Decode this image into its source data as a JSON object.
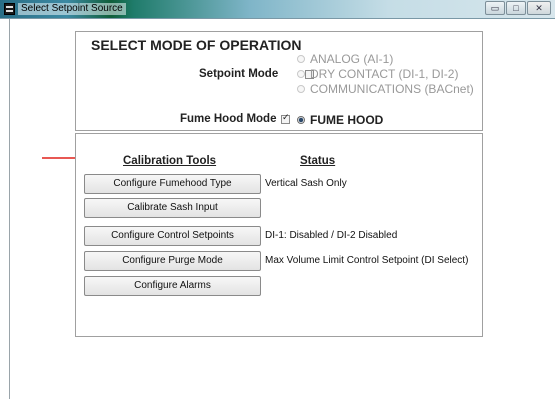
{
  "window": {
    "title": "Select Setpoint Source",
    "buttons": {
      "minimize": "▭",
      "maximize": "□",
      "close": "✕"
    }
  },
  "mode": {
    "heading": "SELECT MODE OF OPERATION",
    "setpoint_label": "Setpoint Mode",
    "setpoint_checked": false,
    "setpoint_options": [
      {
        "label": "ANALOG (AI-1)",
        "selected": false
      },
      {
        "label": "DRY CONTACT (DI-1, DI-2)",
        "selected": false
      },
      {
        "label": "COMMUNICATIONS (BACnet)",
        "selected": false
      }
    ],
    "fume_label": "Fume Hood Mode",
    "fume_checked": true,
    "fume_option": {
      "label": "FUME HOOD",
      "selected": true
    }
  },
  "tools": {
    "col_tools": "Calibration Tools",
    "col_status": "Status",
    "rows": [
      {
        "button": "Configure Fumehood Type",
        "status": "Vertical Sash Only"
      },
      {
        "button": "Calibrate Sash Input",
        "status": ""
      },
      {
        "button": "Configure Control Setpoints",
        "status": "DI-1: Disabled / DI-2 Disabled"
      },
      {
        "button": "Configure Purge Mode",
        "status": "Max Volume Limit Control Setpoint (DI Select)"
      },
      {
        "button": "Configure Alarms",
        "status": ""
      }
    ]
  },
  "colors": {
    "arrow": "#e0201a",
    "accent_radio": "#2d4a6b"
  }
}
